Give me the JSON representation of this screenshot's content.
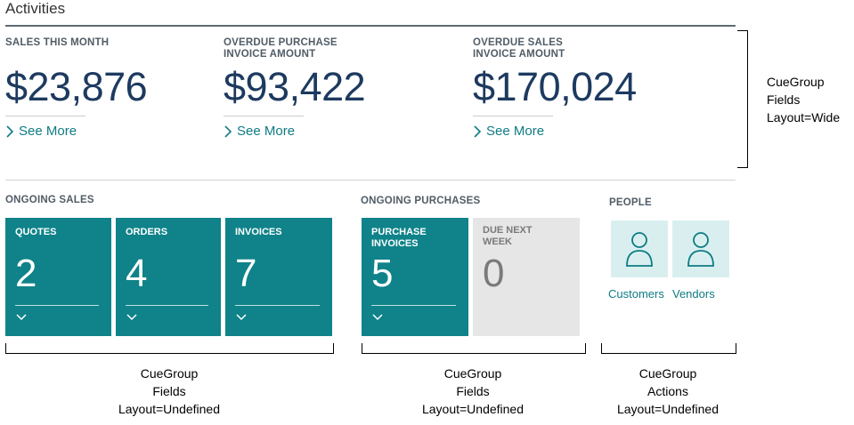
{
  "title": "Activities",
  "wide_group": {
    "items": [
      {
        "label": "SALES THIS MONTH",
        "value": "$23,876",
        "link": "See More"
      },
      {
        "label": "OVERDUE PURCHASE INVOICE AMOUNT",
        "value": "$93,422",
        "link": "See More"
      },
      {
        "label": "OVERDUE SALES INVOICE AMOUNT",
        "value": "$170,024",
        "link": "See More"
      }
    ]
  },
  "ongoing_sales": {
    "label": "ONGOING SALES",
    "tiles": [
      {
        "label": "QUOTES",
        "value": "2"
      },
      {
        "label": "ORDERS",
        "value": "4"
      },
      {
        "label": "INVOICES",
        "value": "7"
      }
    ]
  },
  "ongoing_purchases": {
    "label": "ONGOING PURCHASES",
    "tiles": [
      {
        "label": "PURCHASE INVOICES",
        "value": "5"
      },
      {
        "label": "DUE NEXT WEEK",
        "value": "0"
      }
    ]
  },
  "people": {
    "label": "PEOPLE",
    "actions": [
      {
        "label": "Customers",
        "icon": "person-icon"
      },
      {
        "label": "Vendors",
        "icon": "person-icon"
      }
    ]
  },
  "annotations": {
    "wide": [
      "CueGroup",
      "Fields",
      "Layout=Wide"
    ],
    "sales": [
      "CueGroup",
      "Fields",
      "Layout=Undefined"
    ],
    "purchases": [
      "CueGroup",
      "Fields",
      "Layout=Undefined"
    ],
    "people": [
      "CueGroup",
      "Actions",
      "Layout=Undefined"
    ]
  },
  "colors": {
    "tile": "#0f8389",
    "tile_grey": "#e6e6e6",
    "link": "#0f7b84",
    "value": "#1d3a5f",
    "people_tile": "#d9efef"
  }
}
